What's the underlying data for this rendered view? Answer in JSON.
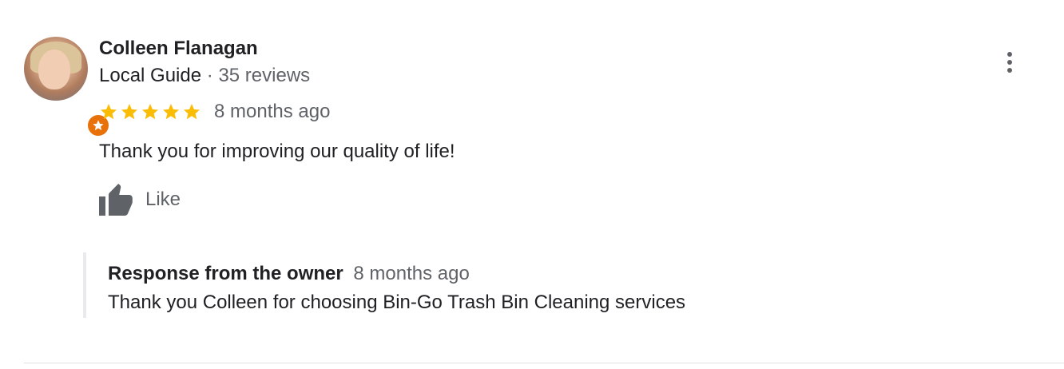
{
  "review": {
    "reviewer_name": "Colleen Flanagan",
    "reviewer_level": "Local Guide",
    "separator": "·",
    "reviews_count": "35 reviews",
    "rating": 5,
    "max_rating": 5,
    "date": "8 months ago",
    "text": "Thank you for improving our quality of life!",
    "like_label": "Like"
  },
  "owner_response": {
    "title": "Response from the owner",
    "date": "8 months ago",
    "text": "Thank you Colleen for choosing Bin-Go Trash Bin Cleaning services"
  },
  "icons": {
    "avatar": "avatar-photo",
    "badge": "local-guide-star-icon",
    "more": "more-vert-icon",
    "star": "star-icon",
    "like": "thumb-up-icon"
  },
  "colors": {
    "star": "#fbbc04",
    "guide_badge": "#e8710a",
    "secondary_text": "#5f6368",
    "primary_text": "#202124",
    "response_border": "#e8eaed"
  }
}
